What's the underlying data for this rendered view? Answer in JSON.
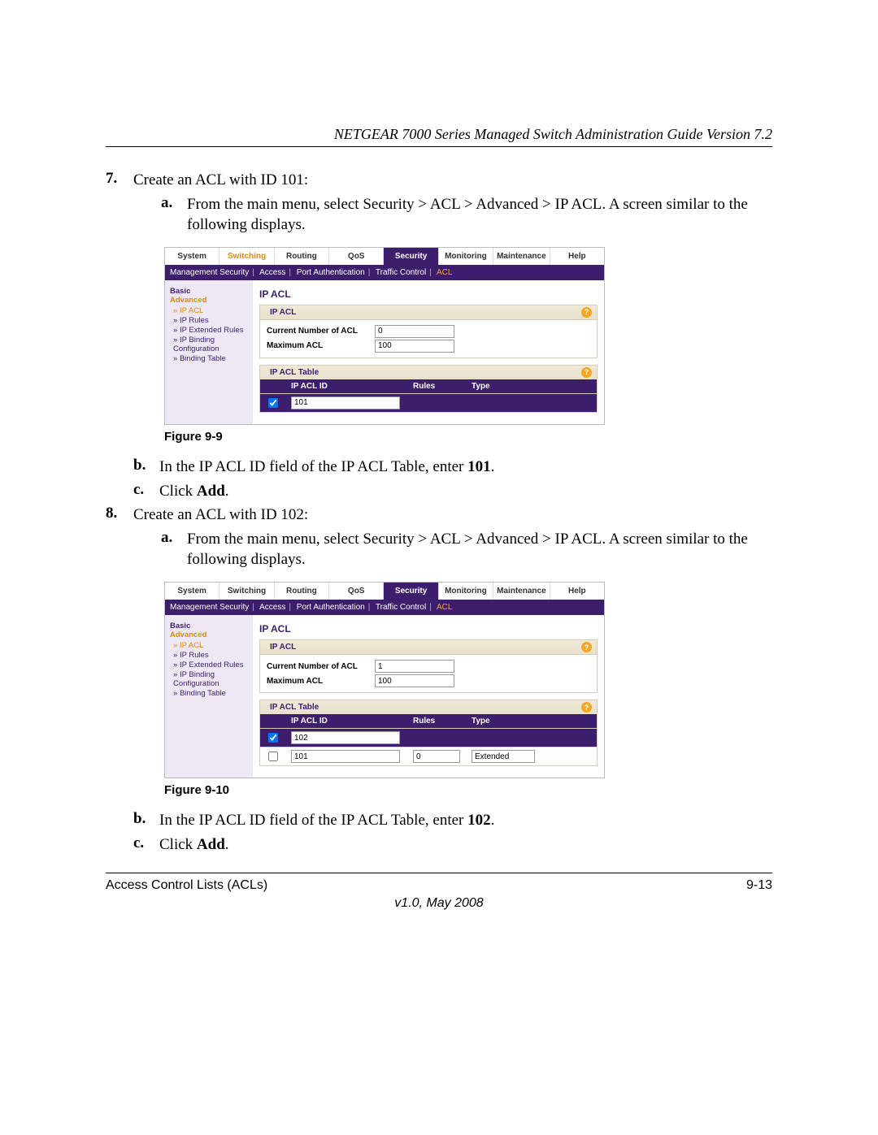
{
  "header": "NETGEAR 7000 Series Managed Switch Administration Guide Version 7.2",
  "step7": {
    "marker": "7.",
    "text": "Create an ACL with ID 101:",
    "a": {
      "marker": "a.",
      "text": "From the main menu, select Security > ACL > Advanced > IP ACL. A screen similar to the following displays."
    },
    "b": {
      "marker": "b.",
      "text_pre": "In the IP ACL ID field of the IP ACL Table, enter ",
      "val": "101",
      "text_post": "."
    },
    "c": {
      "marker": "c.",
      "text_pre": "Click ",
      "bold": "Add",
      "text_post": "."
    }
  },
  "step8": {
    "marker": "8.",
    "text": "Create an ACL with ID 102:",
    "a": {
      "marker": "a.",
      "text": "From the main menu, select Security > ACL > Advanced > IP ACL. A screen similar to the following displays."
    },
    "b": {
      "marker": "b.",
      "text_pre": "In the IP ACL ID field of the IP ACL Table, enter ",
      "val": "102",
      "text_post": "."
    },
    "c": {
      "marker": "c.",
      "text_pre": "Click ",
      "bold": "Add",
      "text_post": "."
    }
  },
  "fig1_cap": "Figure 9-9",
  "fig2_cap": "Figure 9-10",
  "ui": {
    "tabs": {
      "system": "System",
      "switching": "Switching",
      "routing": "Routing",
      "qos": "QoS",
      "security": "Security",
      "monitoring": "Monitoring",
      "maintenance": "Maintenance",
      "help": "Help"
    },
    "subtabs": {
      "ms": "Management Security",
      "access": "Access",
      "pa": "Port Authentication",
      "tc": "Traffic Control",
      "acl": "ACL"
    },
    "sidebar": {
      "basic": "Basic",
      "advanced": "Advanced",
      "items": {
        "ipacl": "IP ACL",
        "iprules": "IP Rules",
        "ipext": "IP Extended Rules",
        "ipbind": "IP Binding Configuration",
        "bt": "Binding Table"
      }
    },
    "main": {
      "title": "IP ACL",
      "panel1": "IP ACL",
      "cur": "Current Number of ACL",
      "max": "Maximum ACL",
      "panel2": "IP ACL Table",
      "col_id": "IP ACL ID",
      "col_rules": "Rules",
      "col_type": "Type"
    }
  },
  "shot1": {
    "cur": "0",
    "max": "100",
    "input": "101"
  },
  "shot2": {
    "cur": "1",
    "max": "100",
    "input": "102",
    "row2_id": "101",
    "row2_rules": "0",
    "row2_type": "Extended"
  },
  "footer": {
    "left": "Access Control Lists (ACLs)",
    "right": "9-13",
    "ver": "v1.0, May 2008"
  }
}
